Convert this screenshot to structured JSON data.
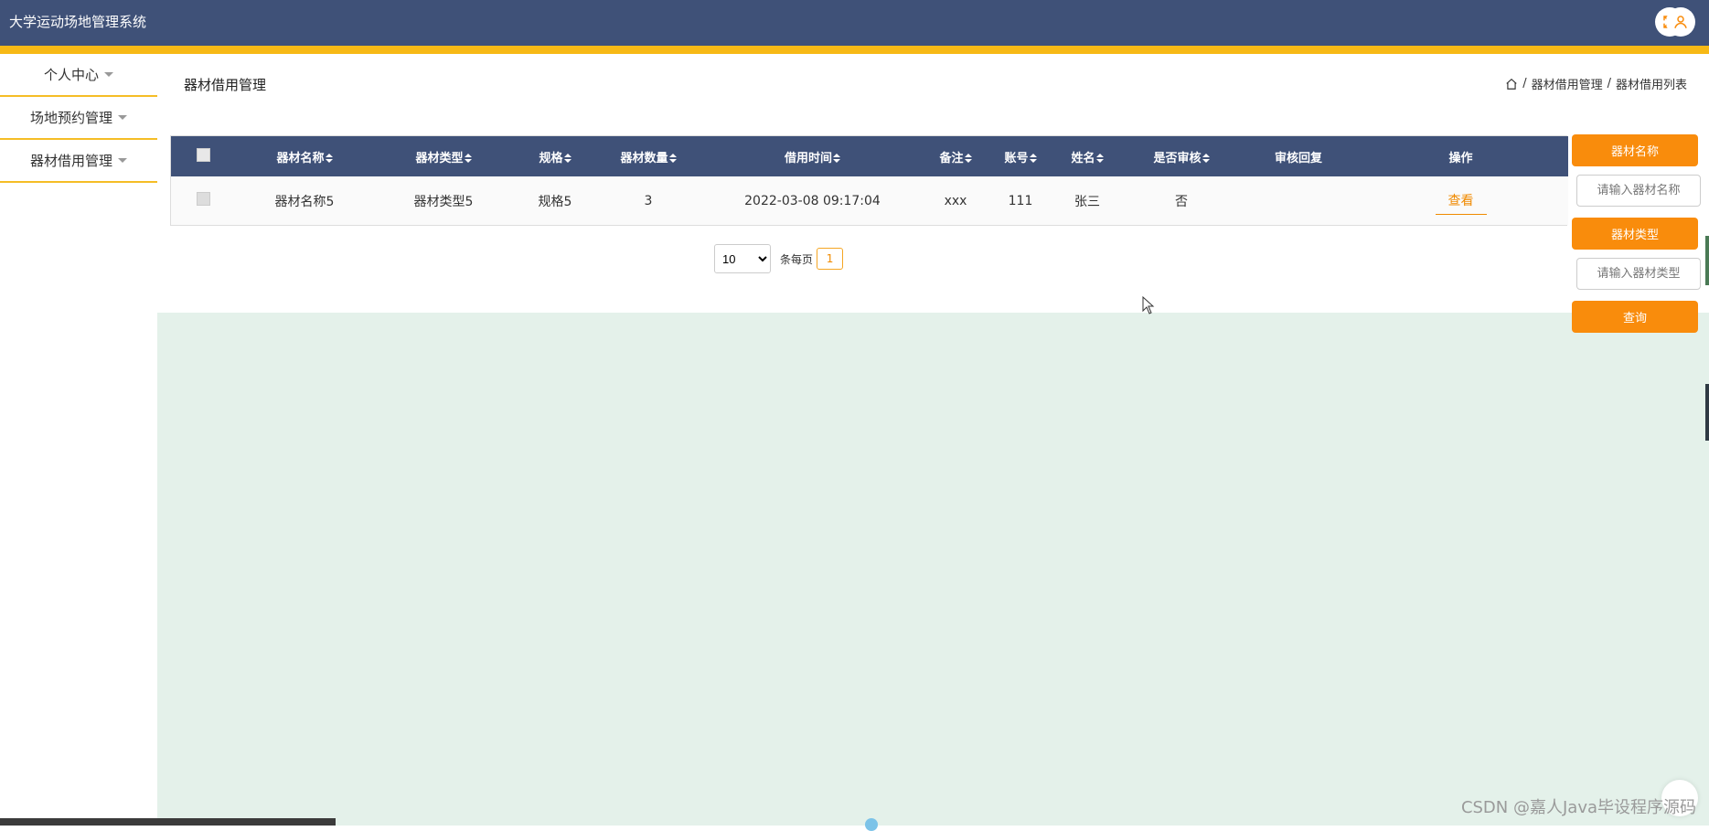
{
  "app": {
    "title": "大学运动场地管理系统"
  },
  "header": {
    "fullscreen_icon": "fullscreen-icon",
    "user_icon": "user-icon"
  },
  "sidebar": {
    "items": [
      {
        "label": "个人中心"
      },
      {
        "label": "场地预约管理"
      },
      {
        "label": "器材借用管理"
      }
    ]
  },
  "page": {
    "title": "器材借用管理",
    "breadcrumb": [
      "器材借用管理",
      "器材借用列表"
    ]
  },
  "table": {
    "columns": [
      "器材名称",
      "器材类型",
      "规格",
      "器材数量",
      "借用时间",
      "备注",
      "账号",
      "姓名",
      "是否审核",
      "审核回复",
      "操作"
    ],
    "rows": [
      {
        "name": "器材名称5",
        "type": "器材类型5",
        "spec": "规格5",
        "quantity": "3",
        "borrow_time": "2022-03-08 09:17:04",
        "remark": "xxx",
        "account": "111",
        "person": "张三",
        "reviewed": "否",
        "reply": "",
        "action": "查看"
      }
    ]
  },
  "pagination": {
    "page_size": "10",
    "per_page_label": "条每页",
    "current_page": "1"
  },
  "search": {
    "name_label": "器材名称",
    "name_placeholder": "请输入器材名称",
    "type_label": "器材类型",
    "type_placeholder": "请输入器材类型",
    "query_button": "查询"
  },
  "watermark": "CSDN @嘉人Java毕设程序源码",
  "colors": {
    "header": "#3f5178",
    "accent": "#f7b916",
    "button": "#f98c0c",
    "content_bg": "#e4f1ea"
  }
}
